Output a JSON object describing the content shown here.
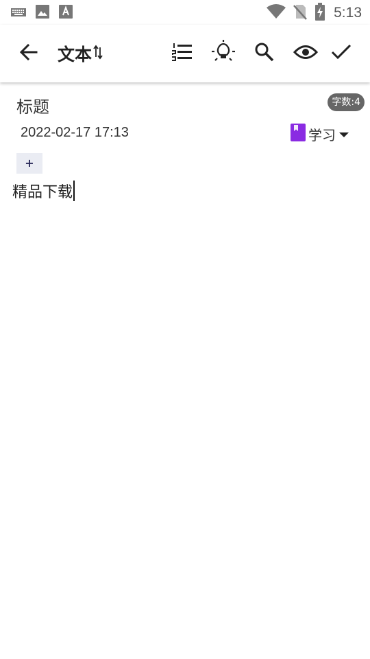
{
  "status_bar": {
    "time": "5:13",
    "icons": [
      "keyboard-icon",
      "image-icon",
      "font-icon",
      "wifi-icon",
      "no-sim-icon",
      "battery-charging-icon"
    ]
  },
  "toolbar": {
    "title": "文本",
    "icons": [
      "back-arrow-icon",
      "sort-arrows-icon",
      "numbered-list-icon",
      "lightbulb-icon",
      "search-icon",
      "eye-icon",
      "check-icon"
    ]
  },
  "note": {
    "title": "标题",
    "word_count": "字数:4",
    "date": "2022-02-17 17:13",
    "category": {
      "label": "学习",
      "color": "#8a2be2"
    },
    "add_tag_label": "+",
    "body": "精品下载"
  }
}
